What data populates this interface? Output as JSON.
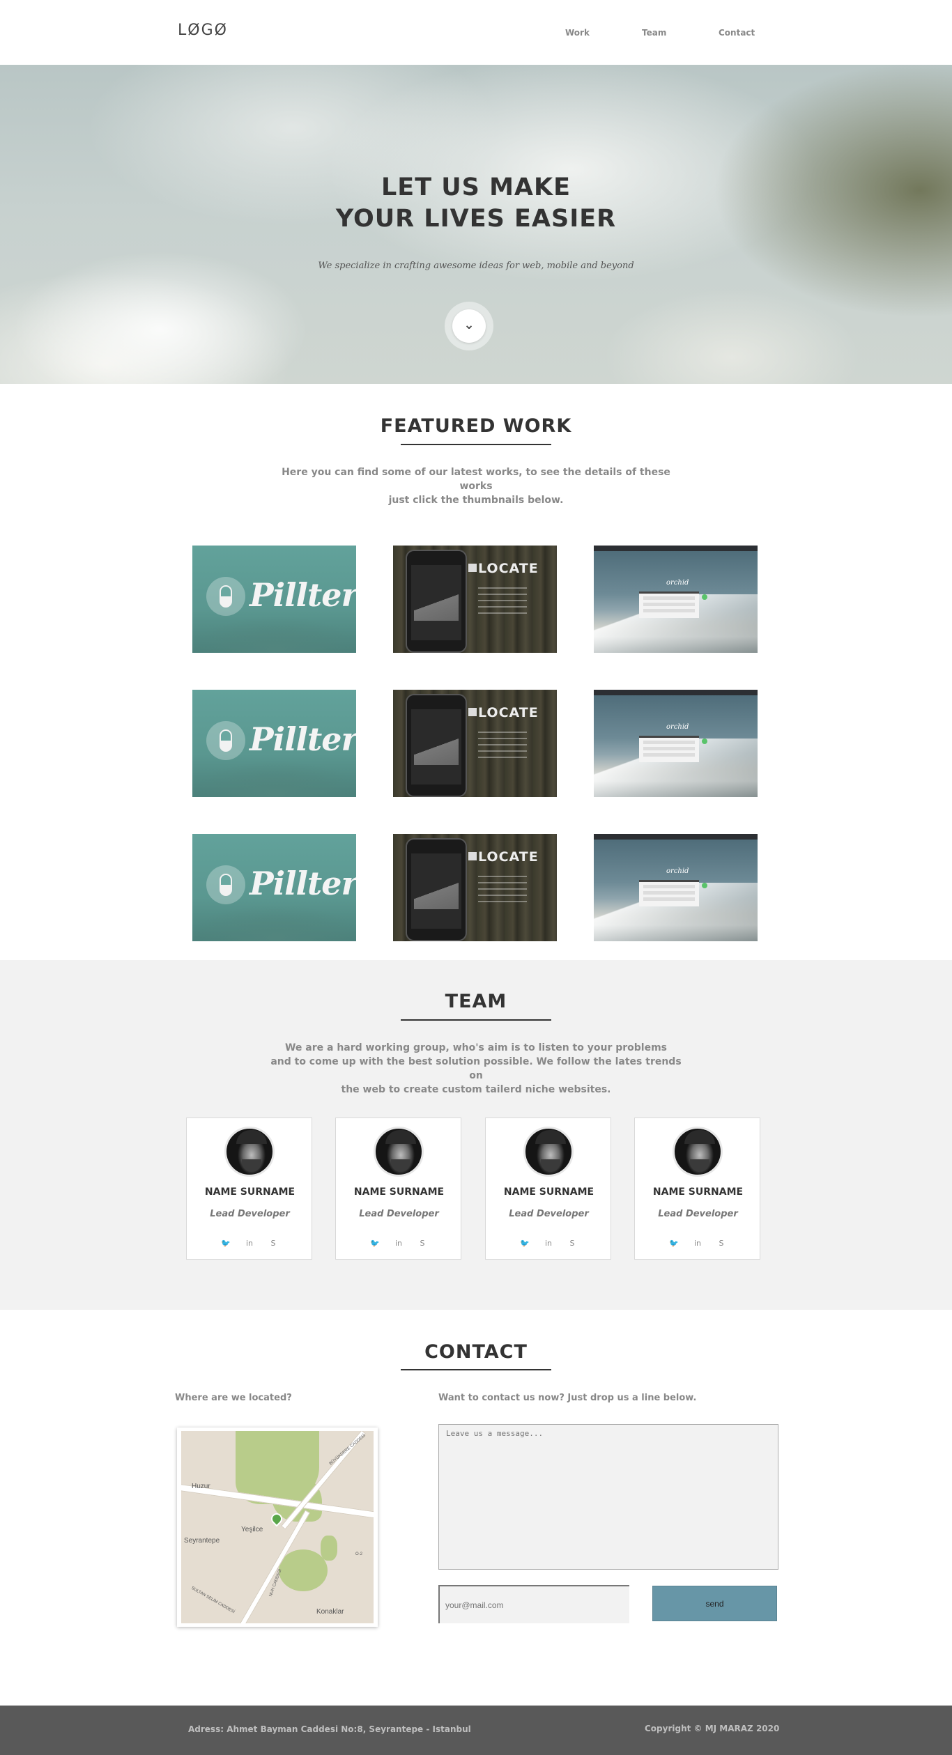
{
  "header": {
    "logo": "LØGØ",
    "nav": [
      {
        "label": "Work"
      },
      {
        "label": "Team"
      },
      {
        "label": "Contact"
      }
    ]
  },
  "hero": {
    "title_line1": "LET US MAKE",
    "title_line2": "YOUR LIVES EASIER",
    "subtitle": "We specialize in crafting awesome ideas for web, mobile and beyond",
    "scroll_icon": "chevron-down-icon",
    "scroll_glyph": "⌄"
  },
  "work": {
    "title": "FEATURED WORK",
    "desc_line1": "Here you can find some of our latest works, to see the details of these works",
    "desc_line2": "just click the thumbnails below.",
    "thumbs": [
      {
        "brand": "Pillter"
      },
      {
        "brand": "LOCATE"
      },
      {
        "brand": "orchid"
      }
    ]
  },
  "team": {
    "title": "TEAM",
    "desc_line1": "We are a hard working group, who's aim is to listen to your problems",
    "desc_line2": "and to come up with the best solution possible. We follow the lates trends on",
    "desc_line3": "the web to create custom tailerd niche websites.",
    "members": [
      {
        "name": "NAME SURNAME",
        "role": "Lead Developer"
      },
      {
        "name": "NAME SURNAME",
        "role": "Lead Developer"
      },
      {
        "name": "NAME SURNAME",
        "role": "Lead Developer"
      },
      {
        "name": "NAME SURNAME",
        "role": "Lead Developer"
      }
    ],
    "social_icons": [
      "twitter-icon",
      "linkedin-icon",
      "skype-icon"
    ],
    "social_glyphs": {
      "twitter": "🐦",
      "linkedin": "in",
      "skype": "S"
    }
  },
  "contact": {
    "title": "CONTACT",
    "location_label": "Where are we located?",
    "form_label": "Want to contact us now? Just drop us a line below.",
    "message_placeholder": "Leave us a message...",
    "email_placeholder": "your@mail.com",
    "send_label": "send",
    "map_labels": {
      "huzur": "Huzur",
      "yesilce": "Yeşilce",
      "seyrantepe": "Seyrantepe",
      "konaklar": "Konaklar",
      "road_top": "BÜYÜKDERE CADDESİ",
      "road_mid": "NUH CADDESİ",
      "road_bottom": "SULTAN SELİM CADDESİ",
      "o2": "O-2"
    }
  },
  "footer": {
    "address": "Adress: Ahmet Bayman Caddesi No:8, Seyrantepe - Istanbul",
    "copyright": "Copyright © MJ MARAZ 2020"
  }
}
